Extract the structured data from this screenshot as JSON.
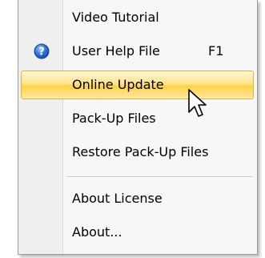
{
  "menu": {
    "items": [
      {
        "label": "Video Tutorial"
      },
      {
        "label": "User Help File",
        "shortcut": "F1",
        "icon": "help-icon"
      },
      {
        "label": "Online Update",
        "state": "hovered"
      },
      {
        "label": "Pack-Up Files"
      },
      {
        "label": "Restore Pack-Up Files"
      },
      {
        "label": "About License"
      },
      {
        "label": "About..."
      }
    ]
  },
  "colors": {
    "highlight": "#ffd24a",
    "highlight_border": "#e2b33a",
    "help_icon": "#2f6fd6"
  },
  "cursor": "arrow-cursor-icon"
}
